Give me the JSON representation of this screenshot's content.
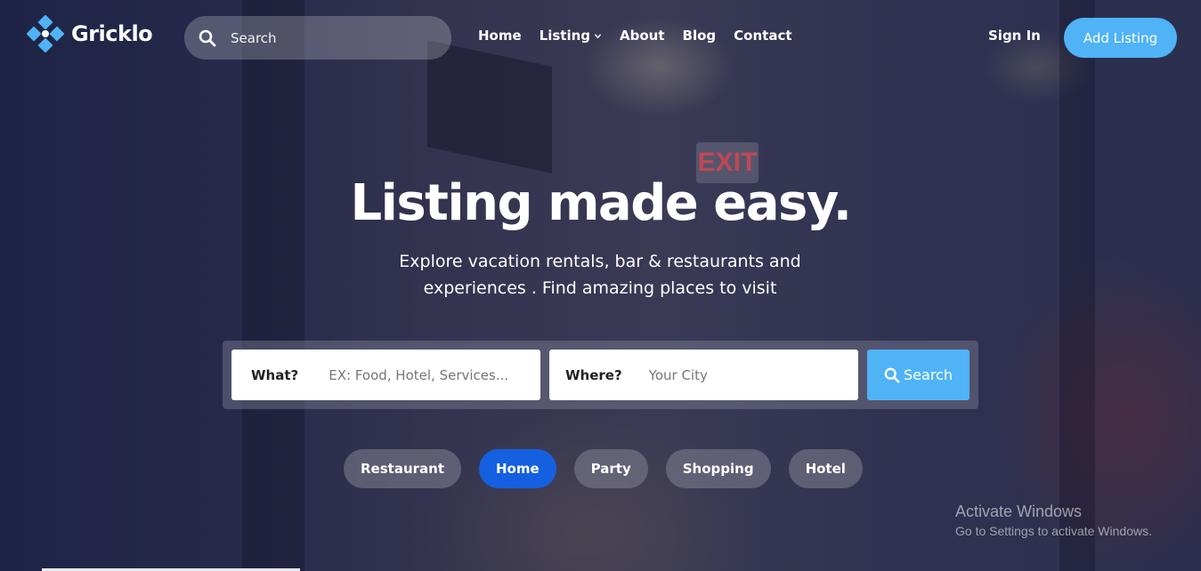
{
  "brand": {
    "name": "Gricklo",
    "accent": "#4fb3f6"
  },
  "header": {
    "search": {
      "placeholder": "Search",
      "icon": "search-icon"
    },
    "nav": [
      {
        "label": "Home"
      },
      {
        "label": "Listing",
        "icon": "chevron-down-icon"
      },
      {
        "label": "About"
      },
      {
        "label": "Blog"
      },
      {
        "label": "Contact"
      }
    ],
    "sign_in": "Sign In",
    "add_listing": "Add Listing"
  },
  "hero": {
    "headline": "Listing made easy.",
    "subtitle": "Explore vacation rentals, bar & restaurants and experiences . Find amazing places to visit"
  },
  "search_form": {
    "what_label": "What?",
    "what_placeholder": "EX: Food, Hotel, Services...",
    "where_label": "Where?",
    "where_placeholder": "Your City",
    "button_label": "Search"
  },
  "categories": [
    {
      "label": "Restaurant",
      "active": false
    },
    {
      "label": "Home",
      "active": true
    },
    {
      "label": "Party",
      "active": false
    },
    {
      "label": "Shopping",
      "active": false
    },
    {
      "label": "Hotel",
      "active": false
    }
  ],
  "watermark": {
    "title": "Activate Windows",
    "subtitle": "Go to Settings to activate Windows."
  },
  "colors": {
    "active_chip": "#1560e0",
    "button": "#4fb3f6"
  }
}
